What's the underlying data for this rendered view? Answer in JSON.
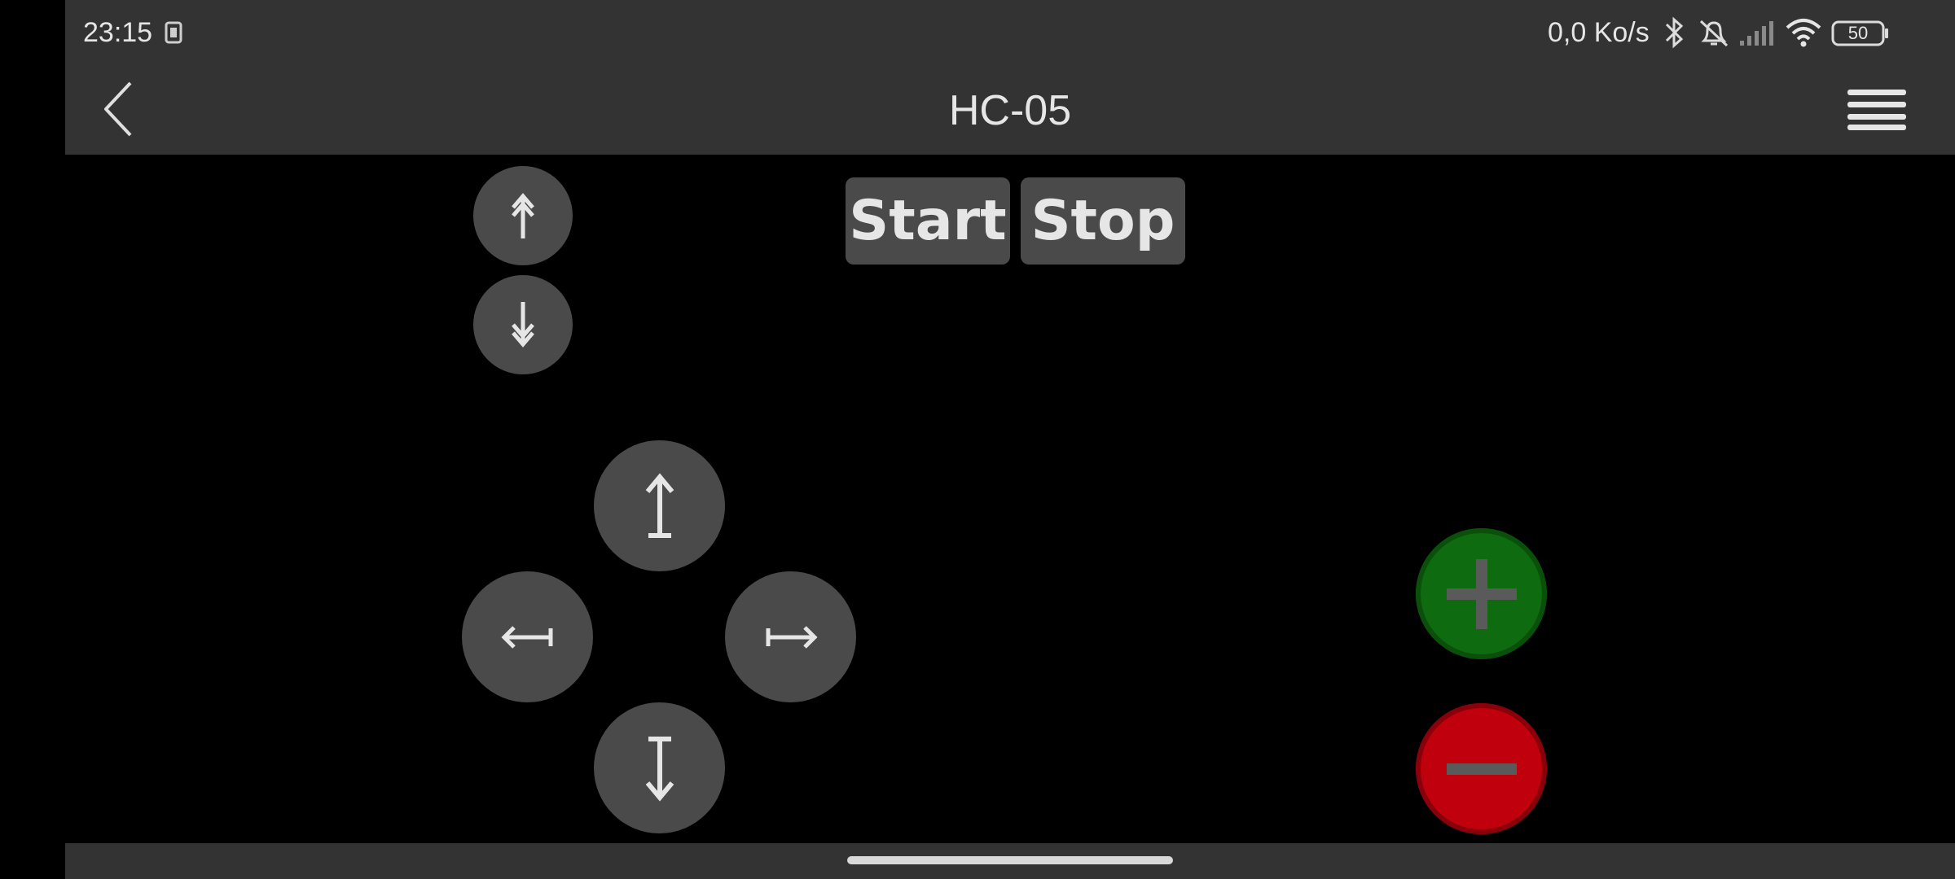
{
  "status_bar": {
    "time": "23:15",
    "network_speed": "0,0 Ko/s",
    "battery": "50",
    "icons": [
      "sim-card-icon",
      "bluetooth-icon",
      "notifications-off-icon",
      "signal-icon",
      "wifi-icon",
      "battery-icon"
    ]
  },
  "app_bar": {
    "title": "HC-05",
    "icons": [
      "back-icon",
      "menu-icon"
    ]
  },
  "controls": {
    "start_label": "Start",
    "stop_label": "Stop",
    "icons": [
      "fast-up-arrow-icon",
      "fast-down-arrow-icon",
      "up-arrow-icon",
      "left-arrow-icon",
      "right-arrow-icon",
      "down-arrow-icon",
      "plus-icon",
      "minus-icon"
    ]
  },
  "colors": {
    "bar_bg": "#333333",
    "button_bg": "#4a4a4a",
    "plus_green": "#0f6b0f",
    "minus_red": "#c0000c"
  }
}
